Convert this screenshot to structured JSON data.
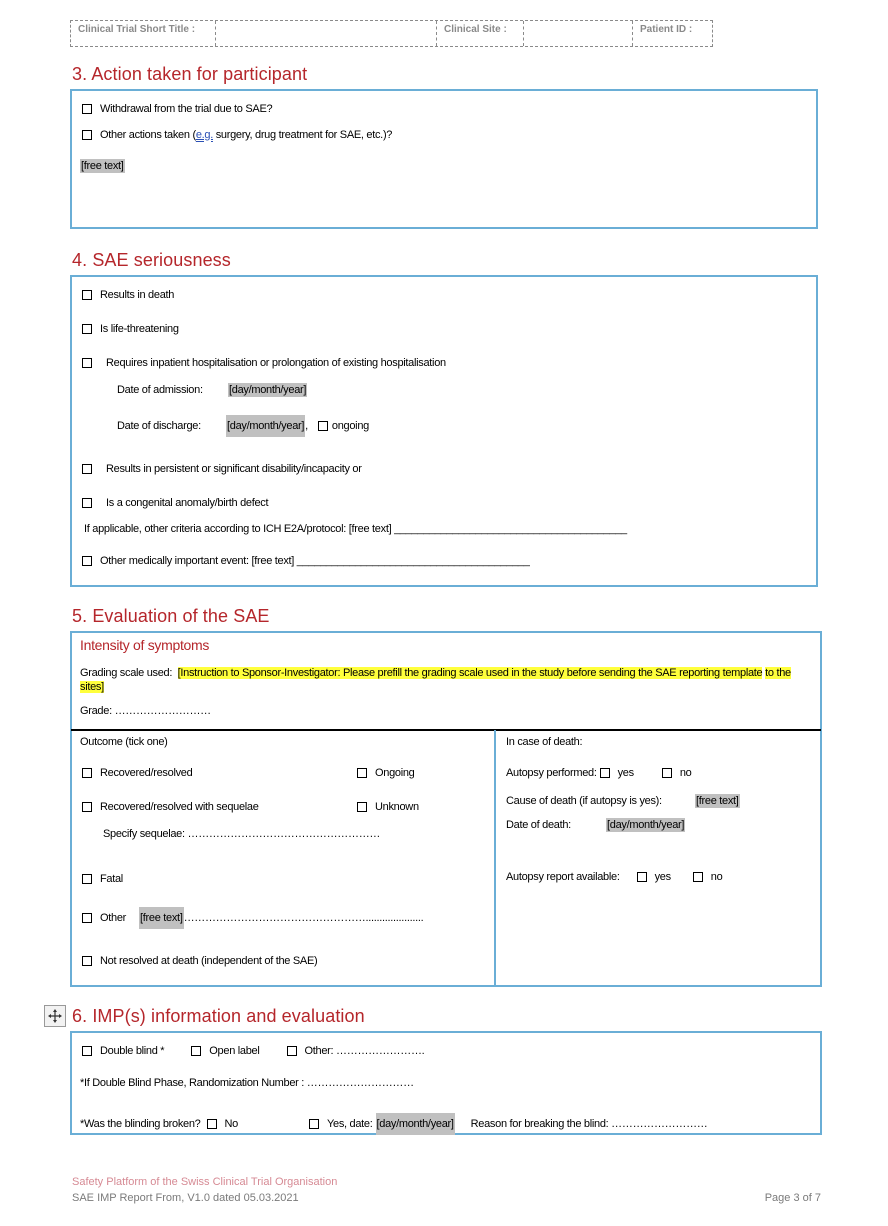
{
  "header": {
    "trial_title_label": "Clinical Trial Short Title :",
    "trial_title_value": "",
    "site_label": "Clinical Site :",
    "site_value": "",
    "patient_label": "Patient ID :"
  },
  "section3": {
    "title": "3. Action taken for participant",
    "items": [
      {
        "label": "Withdrawal from the trial due to SAE?",
        "checked": false
      },
      {
        "label_pre": "Other actions taken (",
        "label_eg": "e.g.",
        "label_post": " surgery, drug treatment for SAE, etc.)?",
        "checked": false
      }
    ],
    "free_text": "[free text]"
  },
  "section4": {
    "title": "4. SAE seriousness",
    "items": [
      {
        "label": "Results in death",
        "checked": false
      },
      {
        "label": "Is life-threatening",
        "checked": false
      },
      {
        "label": "Requires inpatient hospitalisation or prolongation of existing hospitalisation",
        "checked": false
      },
      {
        "label": "Results in persistent or significant disability/incapacity or",
        "checked": false
      },
      {
        "label": "Is a congenital anomaly/birth defect",
        "checked": false
      },
      {
        "label": "Other medically important event: [free text] ________________________________________",
        "checked": false
      }
    ],
    "admission_label": "Date of admission:",
    "admission_value": "[day/month/year]",
    "discharge_label": "Date of discharge:",
    "discharge_value": "[day/month/year]",
    "discharge_sep": ",",
    "ongoing_label": "ongoing",
    "ich_text": "If applicable, other criteria according to ICH E2A/protocol: [free text] ________________________________________"
  },
  "section5": {
    "title": "5. Evaluation of the SAE",
    "intensity_title": "Intensity of symptoms",
    "grading_label": "Grading scale used:",
    "grading_instruction_line1": "[Instruction to Sponsor-Investigator: Please prefill the grading scale used in the study before sending the SAE reporting template",
    "grading_instruction_line2": "to the sites]",
    "grade_text": "Grade: ………………………",
    "outcome_title": "Outcome (tick one)",
    "outcomes": [
      {
        "label": "Recovered/resolved",
        "checked": false
      },
      {
        "label": "Ongoing",
        "checked": false
      },
      {
        "label": "Recovered/resolved with sequelae",
        "checked": false
      },
      {
        "label": "Unknown",
        "checked": false
      },
      {
        "label": "Fatal",
        "checked": false
      },
      {
        "label": "Other",
        "checked": false
      },
      {
        "label": "Not resolved at death (independent of the SAE)",
        "checked": false
      }
    ],
    "sequelae_text": "Specify sequelae:  ………………………………………………",
    "other_free_text": "[free text]",
    "other_dots": "…………………………………………….....................",
    "death_title": "In case of death:",
    "autopsy_label": "Autopsy performed:",
    "yes": "yes",
    "no": "no",
    "cause_label": "Cause of death (if autopsy is yes):",
    "cause_value": "[free text]",
    "death_date_label": "Date of death:",
    "death_date_value": "[day/month/year]",
    "autopsy_report_label": "Autopsy report available:"
  },
  "section6": {
    "title": "6. IMP(s) information and evaluation",
    "double_blind": "Double blind *",
    "open_label": "Open label",
    "other": "Other: …………………….",
    "randomization": "*If Double Blind Phase, Randomization Number : …………………………",
    "blinding_q": "*Was the blinding broken?",
    "no": "No",
    "yes_date": "Yes, date:",
    "date_value": "[day/month/year]",
    "reason": "Reason for breaking the blind: ………………………"
  },
  "footer": {
    "org": "Safety Platform of the Swiss Clinical Trial Organisation",
    "doc": "SAE IMP Report From, V1.0 dated 05.03.2021",
    "page": "Page 3 of 7"
  }
}
